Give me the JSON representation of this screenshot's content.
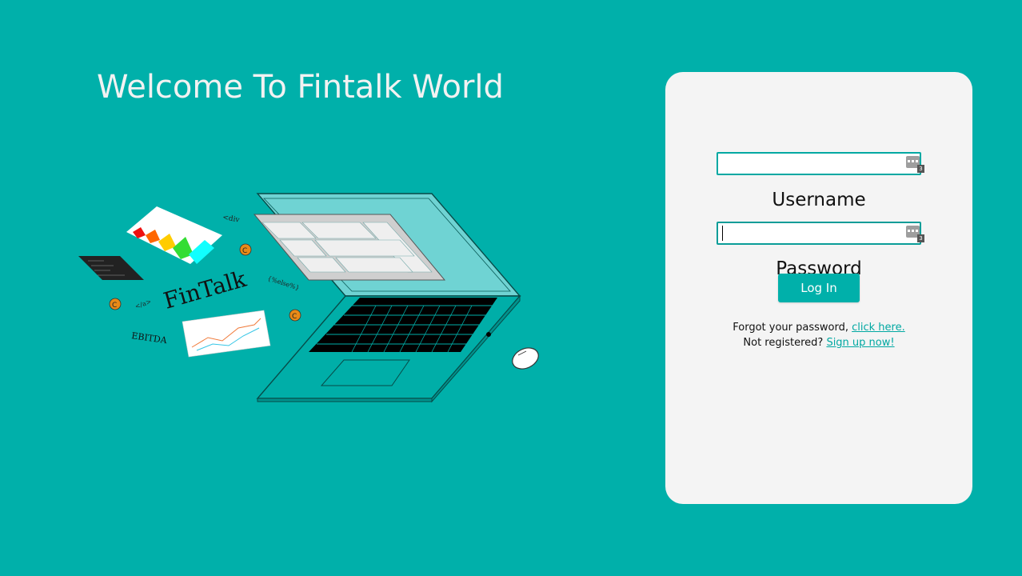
{
  "welcome": {
    "title": "Welcome To Fintalk World"
  },
  "hero": {
    "brand_text": "FinTalk",
    "tags": [
      "<div",
      "{%else%}",
      "</a>",
      "EBITDA"
    ],
    "coin_letter": "C"
  },
  "login": {
    "username_label": "Username",
    "username_value": "",
    "password_label": "Password",
    "password_value": "",
    "button_label": "Log In",
    "forgot_text": "Forgot your password,",
    "forgot_link": "click here.",
    "signup_text": "Not registered?",
    "signup_link": "Sign up now!",
    "extension_badge": "3"
  },
  "colors": {
    "background": "#00b0aa",
    "card": "#f4f4f4",
    "accent": "#00a8a2"
  }
}
